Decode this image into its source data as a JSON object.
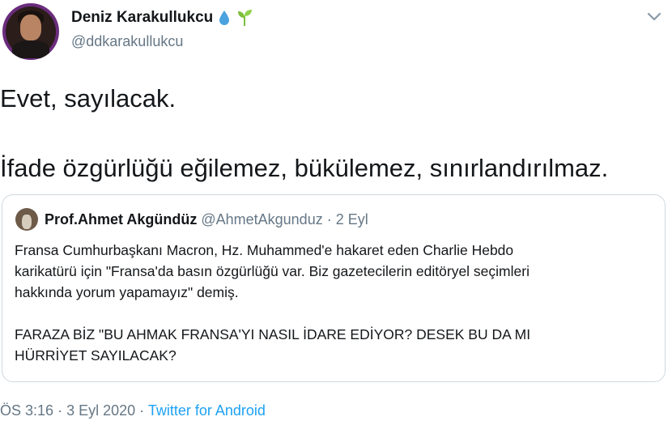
{
  "author": {
    "display_name": "Deniz Karakullukcu",
    "handle": "@ddkarakullukcu",
    "badges": [
      "droplet-icon",
      "seedling-icon"
    ]
  },
  "menu_icon": "chevron-down-icon",
  "tweet": {
    "line1": "Evet, sayılacak.",
    "line2": "İfade özgürlüğü eğilemez, bükülemez, sınırlandırılmaz."
  },
  "quoted": {
    "name": "Prof.Ahmet Akgündüz",
    "handle": "@AhmetAkgunduz",
    "separator": "·",
    "date": "2 Eyl",
    "body_lines": [
      "Fransa Cumhurbaşkanı Macron, Hz. Muhammed'e hakaret eden Charlie Hebdo",
      "karikatürü için \"Fransa'da basın özgürlüğü var. Biz gazetecilerin editöryel seçimleri",
      "hakkında yorum yapamayız\" demiş."
    ],
    "caps_lines": [
      "FARAZA BİZ \"BU AHMAK FRANSA'YI NASIL İDARE EDİYOR? DESEK BU DA MI",
      "HÜRRİYET SAYILACAK?"
    ]
  },
  "footer": {
    "time": "ÖS 3:16",
    "sep1": "·",
    "date": "3 Eyl 2020",
    "sep2": "·",
    "source": "Twitter for Android"
  },
  "colors": {
    "text": "#14171a",
    "secondary": "#657786",
    "link": "#1da1f2",
    "border": "#cfd9de",
    "droplet": "#4aa3df",
    "seedling": "#7cbf3a"
  }
}
